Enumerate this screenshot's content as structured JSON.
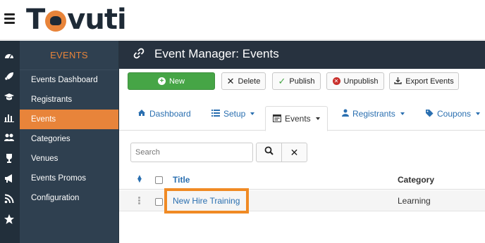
{
  "brand": {
    "logo_text_before": "T",
    "logo_text_after": "vuti",
    "accent_color": "#e8843a"
  },
  "icon_rail": [
    "dashboard-icon",
    "rocket-icon",
    "graduation-cap-icon",
    "bar-chart-icon",
    "users-icon",
    "trophy-icon",
    "megaphone-icon",
    "rss-icon",
    "star-icon"
  ],
  "sidebar": {
    "heading": "EVENTS",
    "items": [
      {
        "label": "Events Dashboard",
        "active": false
      },
      {
        "label": "Registrants",
        "active": false
      },
      {
        "label": "Events",
        "active": true
      },
      {
        "label": "Categories",
        "active": false
      },
      {
        "label": "Venues",
        "active": false
      },
      {
        "label": "Events Promos",
        "active": false
      },
      {
        "label": "Configuration",
        "active": false
      }
    ]
  },
  "header": {
    "title": "Event Manager: Events"
  },
  "toolbar": {
    "new_label": "New",
    "delete_label": "Delete",
    "publish_label": "Publish",
    "unpublish_label": "Unpublish",
    "export_label": "Export Events"
  },
  "tabs": [
    {
      "label": "Dashboard",
      "dropdown": false
    },
    {
      "label": "Setup",
      "dropdown": true
    },
    {
      "label": "Events",
      "dropdown": true,
      "active": true
    },
    {
      "label": "Registrants",
      "dropdown": true
    },
    {
      "label": "Coupons",
      "dropdown": true
    }
  ],
  "search": {
    "placeholder": "Search"
  },
  "table": {
    "columns": [
      "Title",
      "Category"
    ],
    "rows": [
      {
        "title": "New Hire Training",
        "category": "Learning"
      }
    ]
  }
}
